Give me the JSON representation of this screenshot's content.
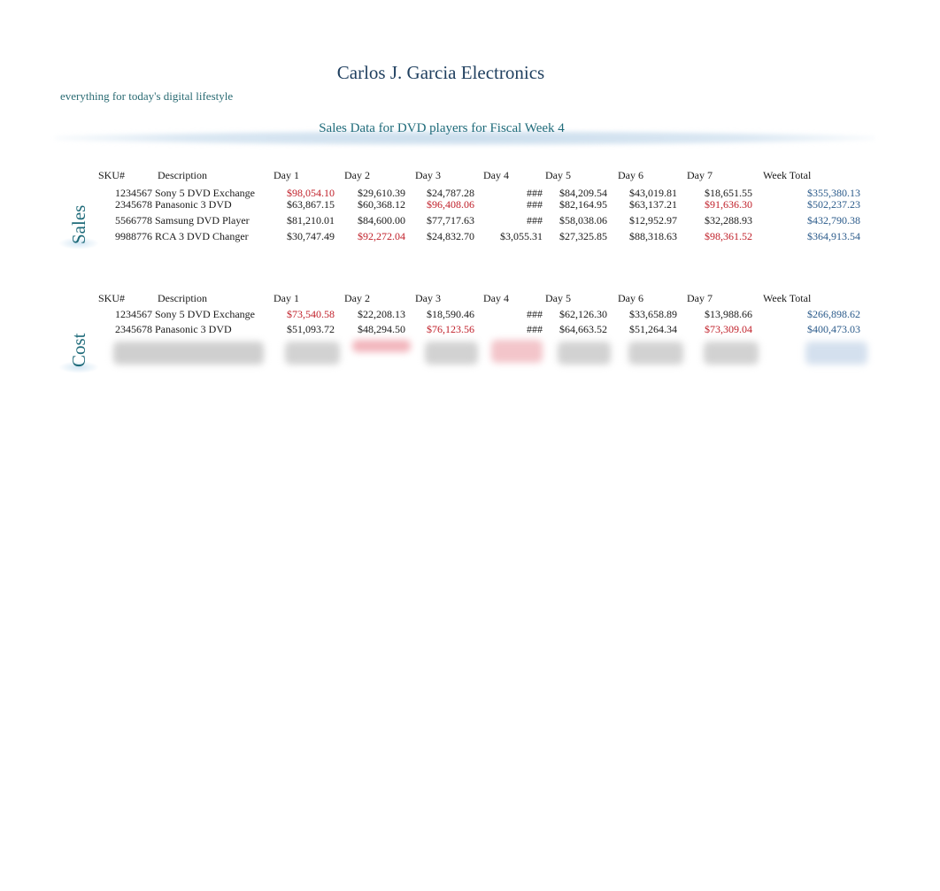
{
  "header": {
    "title": "Carlos J. Garcia Electronics",
    "tagline": "everything for today's digital lifestyle",
    "subtitle": "Sales Data for DVD players for Fiscal Week 4"
  },
  "columns": [
    "SKU#",
    "Description",
    "Day 1",
    "Day 2",
    "Day 3",
    "Day 4",
    "Day 5",
    "Day 6",
    "Day 7",
    "Week Total"
  ],
  "colors": {
    "highlight": "#c0202a",
    "total": "#2a5a8a",
    "accent": "#1f6b7a"
  },
  "sales": {
    "label": "Sales",
    "rows": [
      {
        "sku": "1234567",
        "desc": "Sony 5 DVD Exchange",
        "days": [
          "$98,054.10",
          "$29,610.39",
          "$24,787.28",
          "###",
          "$84,209.54",
          "$43,019.81",
          "$18,651.55"
        ],
        "total": "$355,380.13",
        "high": [
          0
        ]
      },
      {
        "sku": "2345678",
        "desc": "Panasonic 3 DVD",
        "days": [
          "$63,867.15",
          "$60,368.12",
          "$96,408.06",
          "###",
          "$82,164.95",
          "$63,137.21",
          "$91,636.30"
        ],
        "total": "$502,237.23",
        "high": [
          2,
          6
        ]
      },
      {
        "sku": "5566778",
        "desc": "Samsung DVD Player",
        "days": [
          "$81,210.01",
          "$84,600.00",
          "$77,717.63",
          "###",
          "$58,038.06",
          "$12,952.97",
          "$32,288.93"
        ],
        "total": "$432,790.38",
        "high": []
      },
      {
        "sku": "9988776",
        "desc": "RCA 3 DVD Changer",
        "days": [
          "$30,747.49",
          "$92,272.04",
          "$24,832.70",
          "$3,055.31",
          "$27,325.85",
          "$88,318.63",
          "$98,361.52"
        ],
        "total": "$364,913.54",
        "high": [
          1,
          6
        ]
      }
    ]
  },
  "cost": {
    "label": "Cost",
    "rows": [
      {
        "sku": "1234567",
        "desc": "Sony 5 DVD Exchange",
        "days": [
          "$73,540.58",
          "$22,208.13",
          "$18,590.46",
          "###",
          "$62,126.30",
          "$33,658.89",
          "$13,988.66"
        ],
        "total": "$266,898.62",
        "high": [
          0
        ]
      },
      {
        "sku": "2345678",
        "desc": "Panasonic 3 DVD",
        "days": [
          "$51,093.72",
          "$48,294.50",
          "$76,123.56",
          "###",
          "$64,663.52",
          "$51,264.34",
          "$73,309.04"
        ],
        "total": "$400,473.03",
        "high": [
          2,
          6
        ]
      }
    ]
  }
}
